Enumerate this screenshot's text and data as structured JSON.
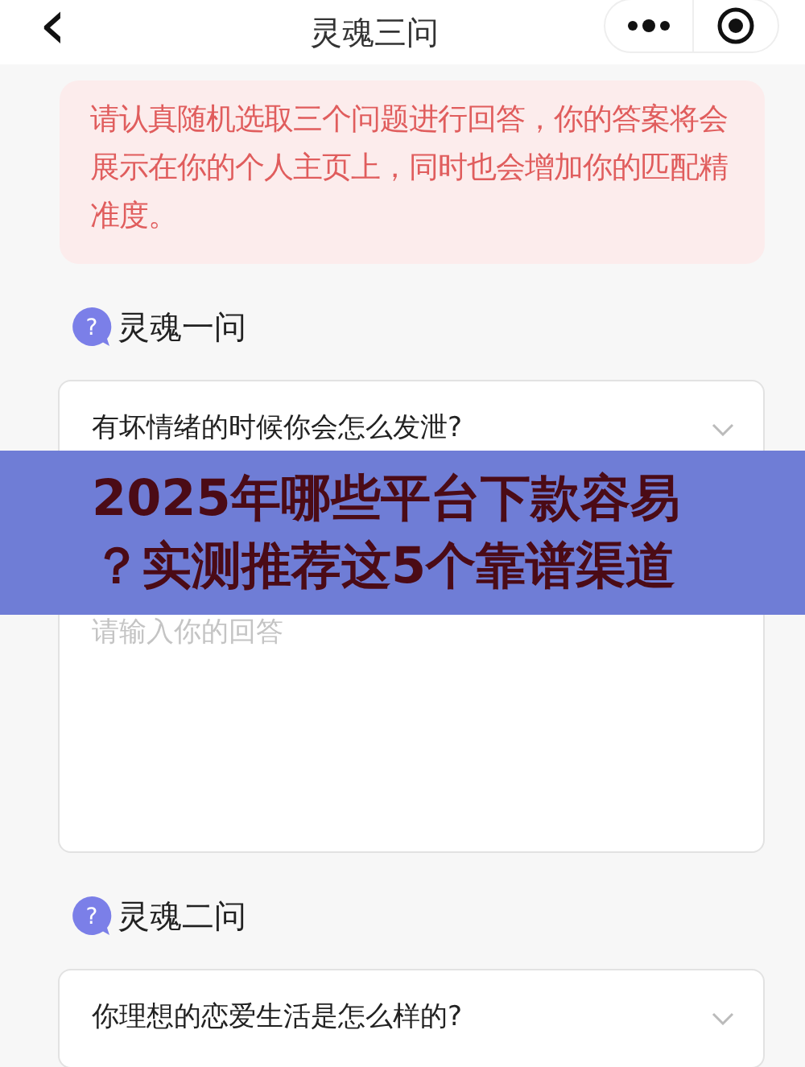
{
  "header": {
    "back": "‹",
    "title": "灵魂三问"
  },
  "notice": "请认真随机选取三个问题进行回答，你的答案将会展示在你的个人主页上，同时也会增加你的匹配精准度。",
  "questions": [
    {
      "title": "灵魂一问",
      "badge": "?",
      "question": "有坏情绪的时候你会怎么发泄?",
      "answer_placeholder": "请输入你的回答"
    },
    {
      "title": "灵魂二问",
      "badge": "?",
      "question": "你理想的恋爱生活是怎么样的?"
    }
  ],
  "banner": "2025年哪些平台下款容易？实测推荐这5个靠谱渠道"
}
